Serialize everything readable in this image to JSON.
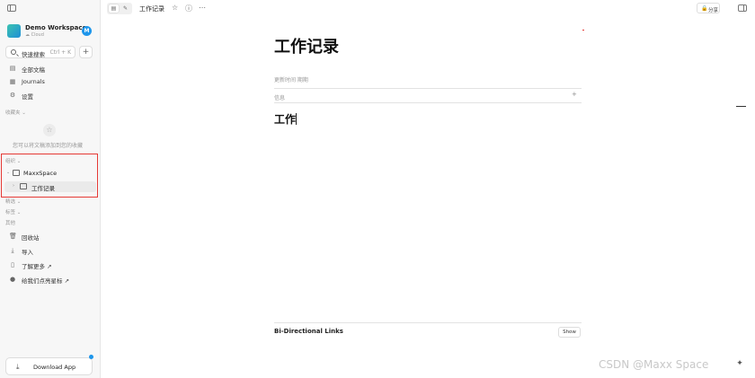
{
  "workspace": {
    "name": "Demo Workspace",
    "sub": "Cloud",
    "avatar": "M"
  },
  "search": {
    "label": "快速搜索",
    "shortcut": "Ctrl + K"
  },
  "nav": {
    "items": [
      {
        "label": "全部文稿",
        "icon": "docs-icon"
      },
      {
        "label": "Journals",
        "icon": "calendar-icon"
      },
      {
        "label": "设置",
        "icon": "gear-icon"
      }
    ]
  },
  "favorites": {
    "header": "收藏夹 ⌄",
    "empty": "您可以将文稿添加到您的收藏"
  },
  "organize": {
    "header": "组织 ⌄",
    "folder": "MaxxSpace",
    "doc": "工作记录"
  },
  "sections": {
    "collections": "精选 ⌄",
    "tags": "标签 ⌄",
    "others": "其他"
  },
  "others": {
    "items": [
      {
        "label": "回收站",
        "icon": "trash-icon"
      },
      {
        "label": "导入",
        "icon": "import-icon"
      },
      {
        "label": "了解更多 ↗",
        "icon": "book-icon"
      },
      {
        "label": "给我们点亮星标 ↗",
        "icon": "github-icon"
      }
    ]
  },
  "download": {
    "label": "Download App"
  },
  "topbar": {
    "title": "工作记录",
    "share": "分享"
  },
  "doc": {
    "title": "工作记录",
    "prop_updated": "更新时间 期期",
    "prop_info": "信息",
    "heading": "工作"
  },
  "links": {
    "label": "Bi-Directional Links",
    "show": "Show"
  },
  "watermark": "CSDN @Maxx Space"
}
